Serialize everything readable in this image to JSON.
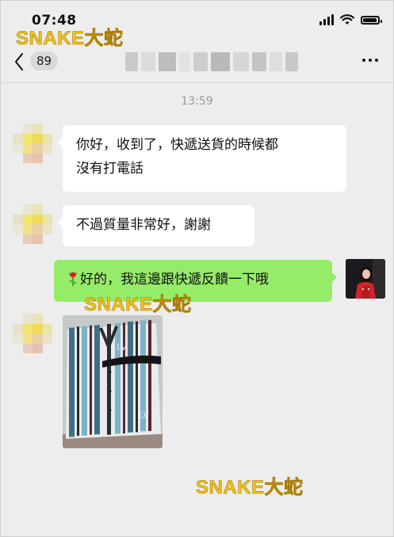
{
  "status_bar": {
    "time": "07:48",
    "battery_level": 0.95
  },
  "nav": {
    "unread_count": "89"
  },
  "timestamp": "13:59",
  "messages": [
    {
      "side": "left",
      "text": "你好，收到了，快遞送貨的時候都\n沒有打電話"
    },
    {
      "side": "left",
      "text": "不過質量非常好，謝謝"
    },
    {
      "side": "right",
      "text": "好的，我這邊跟快遞反饋一下哦",
      "icon": "rose-icon"
    },
    {
      "side": "left",
      "type": "image",
      "icon": "jacket-photo"
    }
  ],
  "watermarks": [
    "SNAKE大蛇",
    "SNAKE大蛇",
    "SNAKE大蛇"
  ],
  "colors": {
    "background": "#ededed",
    "bubble_in": "#ffffff",
    "bubble_out": "#95ec69",
    "watermark": "#f0c419"
  }
}
